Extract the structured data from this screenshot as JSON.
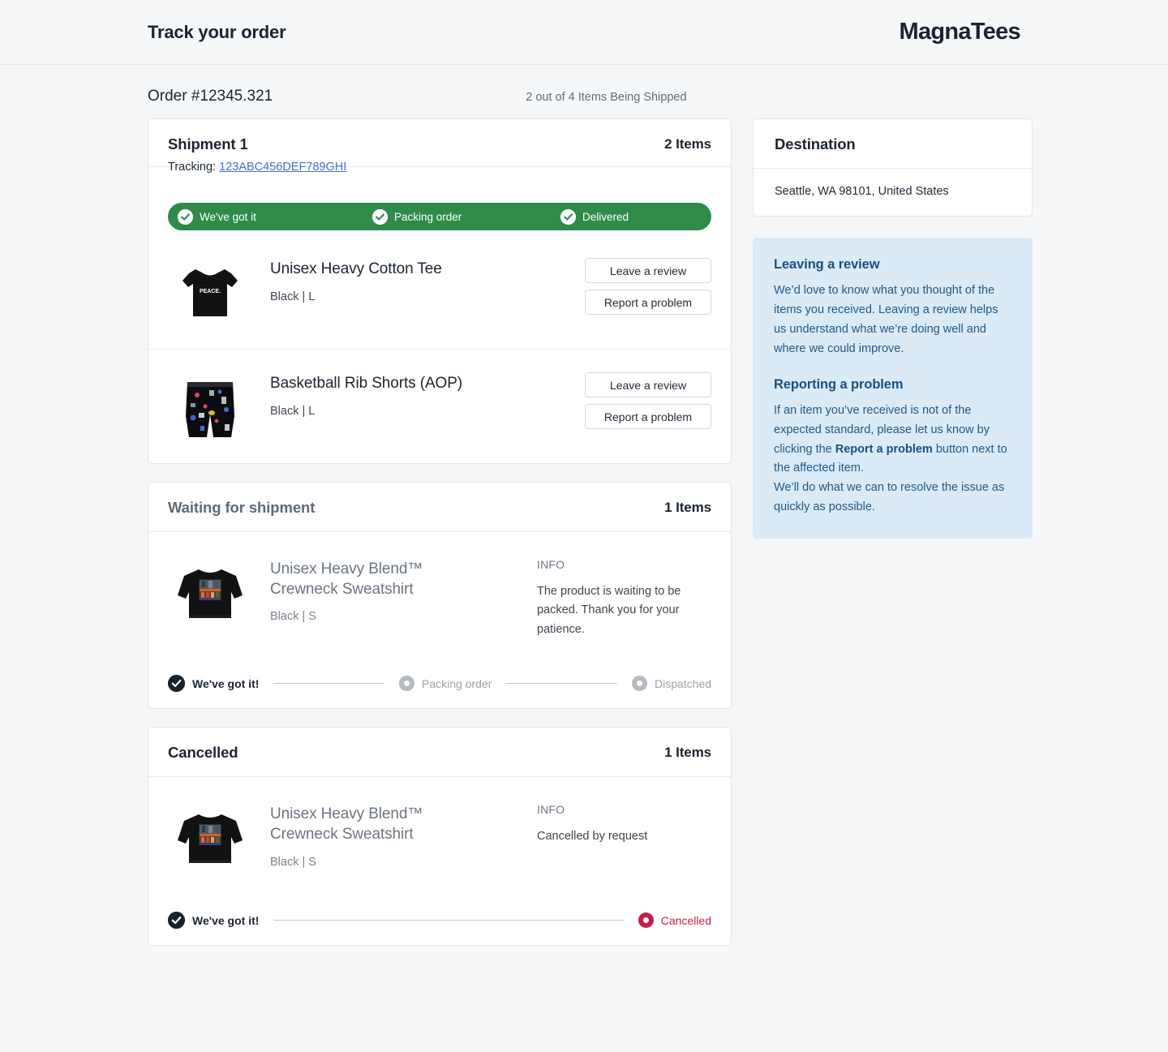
{
  "header": {
    "page_title": "Track your order",
    "brand": "MagnaTees"
  },
  "order": {
    "number": "Order #12345.321",
    "status_summary": "2 out of 4 Items Being Shipped"
  },
  "shipment": {
    "title": "Shipment 1",
    "count": "2 Items",
    "tracking_label": "Tracking:",
    "tracking_number": "123ABC456DEF789GHI",
    "progress": {
      "color": "#2e8b4a",
      "steps": [
        {
          "label": "We've got it",
          "state": "done"
        },
        {
          "label": "Packing order",
          "state": "done"
        },
        {
          "label": "Delivered",
          "state": "done"
        }
      ]
    },
    "items": [
      {
        "name": "Unisex Heavy Cotton Tee",
        "variant": "Black | L",
        "image": "black-tshirt-peace-print",
        "buttons": {
          "review": "Leave a review",
          "problem": "Report a problem"
        }
      },
      {
        "name": "Basketball Rib Shorts (AOP)",
        "variant": "Black | L",
        "image": "black-patterned-basketball-shorts",
        "buttons": {
          "review": "Leave a review",
          "problem": "Report a problem"
        }
      }
    ]
  },
  "waiting": {
    "title": "Waiting for shipment",
    "count": "1 Items",
    "item": {
      "name_line1": "Unisex Heavy Blend™",
      "name_line2": "Crewneck Sweatshirt",
      "variant": "Black | S",
      "image": "black-crewneck-sweatshirt-graphic"
    },
    "info_label": "INFO",
    "info_text": "The product is waiting to be packed. Thank you for your patience.",
    "steps": [
      {
        "label": "We've got it!",
        "state": "done"
      },
      {
        "label": "Packing order",
        "state": "todo"
      },
      {
        "label": "Dispatched",
        "state": "todo"
      }
    ]
  },
  "cancelled": {
    "title": "Cancelled",
    "count": "1 Items",
    "item": {
      "name_line1": "Unisex Heavy Blend™",
      "name_line2": "Crewneck Sweatshirt",
      "variant": "Black | S",
      "image": "black-crewneck-sweatshirt-graphic"
    },
    "info_label": "INFO",
    "info_text": "Cancelled by request",
    "steps": [
      {
        "label": "We've got it!",
        "state": "done"
      },
      {
        "label": "Cancelled",
        "state": "cancelled",
        "color": "#c42046"
      }
    ]
  },
  "destination": {
    "title": "Destination",
    "address": "Seattle, WA 98101, United States"
  },
  "notes": {
    "background": "#daeaf7",
    "review": {
      "title": "Leaving a review",
      "body": "We’d love to know what you thought of the items you received. Leaving a review helps us understand what we’re doing well and where we could improve."
    },
    "problem": {
      "title": "Reporting a problem",
      "body_part1": "If an item you’ve received is not of the expected standard, please let us know by clicking the ",
      "body_strong": "Report a problem",
      "body_part2": " button next to the affected item.",
      "body_part3": "We’ll do what we can to resolve the issue as quickly as possible."
    }
  }
}
